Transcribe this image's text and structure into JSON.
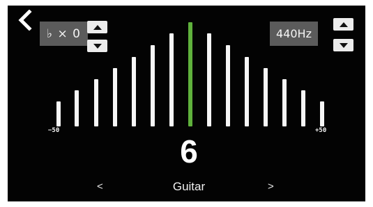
{
  "header": {
    "back_icon": "chevron-left-icon"
  },
  "calibration": {
    "flat_label": "♭ × 0",
    "frequency_label": "440Hz",
    "up_icon": "triangle-up-icon",
    "down_icon": "triangle-down-icon"
  },
  "meter": {
    "scale_min_label": "−50",
    "scale_max_label": "+50",
    "center_color": "#5fb13c",
    "bar_color": "#f6f6f6"
  },
  "tuner": {
    "string_number": "6",
    "mode_name": "Guitar",
    "prev_label": "<",
    "next_label": ">"
  }
}
